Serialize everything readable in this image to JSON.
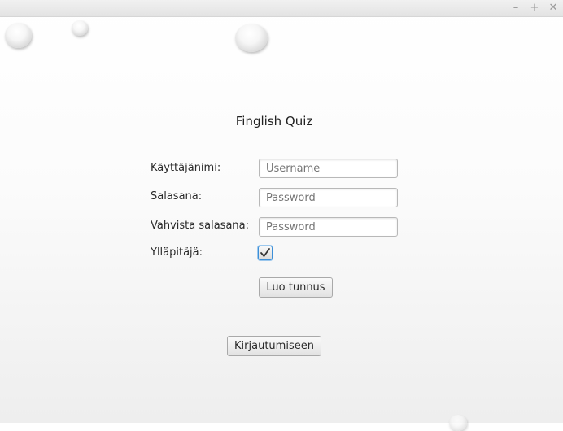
{
  "window": {
    "minimize_symbol": "–",
    "maximize_symbol": "+",
    "close_symbol": "✕"
  },
  "form": {
    "title": "Finglish Quiz",
    "username_label": "Käyttäjänimi:",
    "username_placeholder": "Username",
    "password_label": "Salasana:",
    "password_placeholder": "Password",
    "confirm_label": "Vahvista salasana:",
    "confirm_placeholder": "Password",
    "admin_label": "Ylläpitäjä:",
    "admin_checked": true,
    "create_button": "Luo tunnus",
    "login_button": "Kirjautumiseen"
  },
  "colors": {
    "focus_accent": "#3c8fd8"
  },
  "icons": {
    "admin_checkbox_mark": "checkmark-icon"
  }
}
